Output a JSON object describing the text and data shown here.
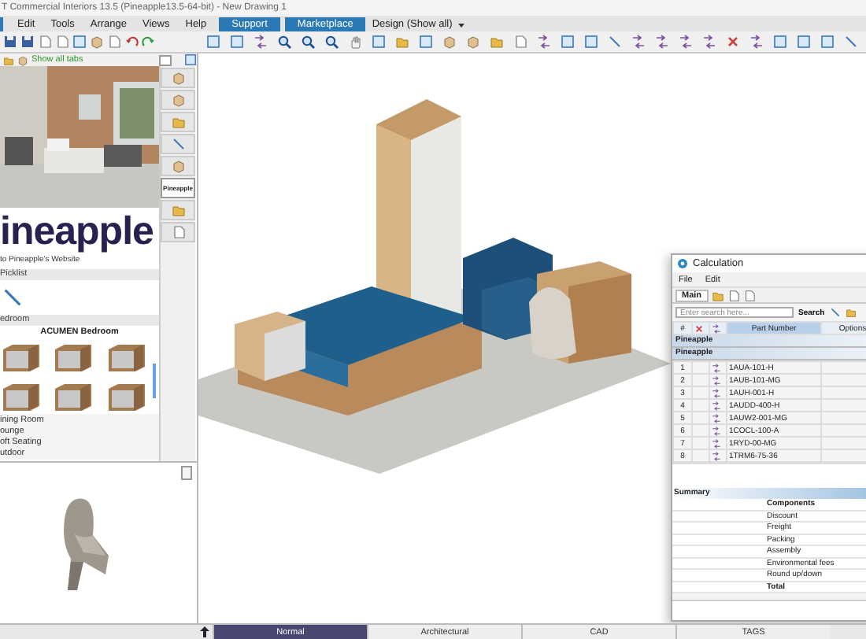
{
  "window": {
    "title": "T Commercial Interiors 13.5 (Pineapple13.5-64-bit) - New Drawing 1"
  },
  "menu": [
    "Edit",
    "Tools",
    "Arrange",
    "Views",
    "Help"
  ],
  "menu_buttons": [
    "Support",
    "Marketplace"
  ],
  "design_dropdown": {
    "value": "Design (Show all)"
  },
  "catalog": {
    "tab_filter": "Show all tabs",
    "brand": "ineapple",
    "website_link": "to Pineapple's Website",
    "picklist": {
      "title": "Picklist"
    },
    "section": {
      "title": "edroom",
      "heading": "ACUMEN Bedroom"
    },
    "categories": [
      "ining Room",
      "ounge",
      "oft Seating",
      "utdoor"
    ]
  },
  "side_tabs": [
    {
      "kind": "icon",
      "selected": false
    },
    {
      "kind": "icon",
      "selected": false
    },
    {
      "kind": "icon",
      "selected": false
    },
    {
      "kind": "icon",
      "selected": false
    },
    {
      "kind": "icon",
      "selected": false
    },
    {
      "kind": "text",
      "label": "Pineapple",
      "selected": true
    },
    {
      "kind": "icon",
      "selected": false
    },
    {
      "kind": "icon",
      "selected": false
    }
  ],
  "calculation": {
    "title": "Calculation",
    "menu": [
      "File",
      "Edit"
    ],
    "tab": {
      "label": "Main",
      "selected": true
    },
    "search": {
      "placeholder": "Enter search here...",
      "button": "Search"
    },
    "columns": [
      "#",
      "Part Number",
      "Options"
    ],
    "group": "Pineapple",
    "subgroup": "Pineapple",
    "rows": [
      {
        "index": "1",
        "part_number": "1AUA-101-H"
      },
      {
        "index": "2",
        "part_number": "1AUB-101-MG"
      },
      {
        "index": "3",
        "part_number": "1AUH-001-H"
      },
      {
        "index": "4",
        "part_number": "1AUDD-400-H"
      },
      {
        "index": "5",
        "part_number": "1AUW2-001-MG"
      },
      {
        "index": "6",
        "part_number": "1COCL-100-A"
      },
      {
        "index": "7",
        "part_number": "1RYD-00-MG"
      },
      {
        "index": "8",
        "part_number": "1TRM6-75-36"
      }
    ],
    "summary": {
      "title": "Summary",
      "items": [
        {
          "label": "Components",
          "kind": "heading"
        },
        {
          "label": "Discount",
          "kind": "item"
        },
        {
          "label": "Freight",
          "kind": "item"
        },
        {
          "label": "Packing",
          "kind": "item"
        },
        {
          "label": "Assembly",
          "kind": "item"
        },
        {
          "label": "Environmental fees",
          "kind": "item"
        },
        {
          "label": "Round up/down",
          "kind": "item"
        },
        {
          "label": "Total",
          "kind": "total"
        }
      ]
    }
  },
  "view_tabs": [
    {
      "label": "Normal",
      "selected": true
    },
    {
      "label": "Architectural",
      "selected": false
    },
    {
      "label": "CAD",
      "selected": false
    },
    {
      "label": "TAGS",
      "selected": false
    }
  ]
}
